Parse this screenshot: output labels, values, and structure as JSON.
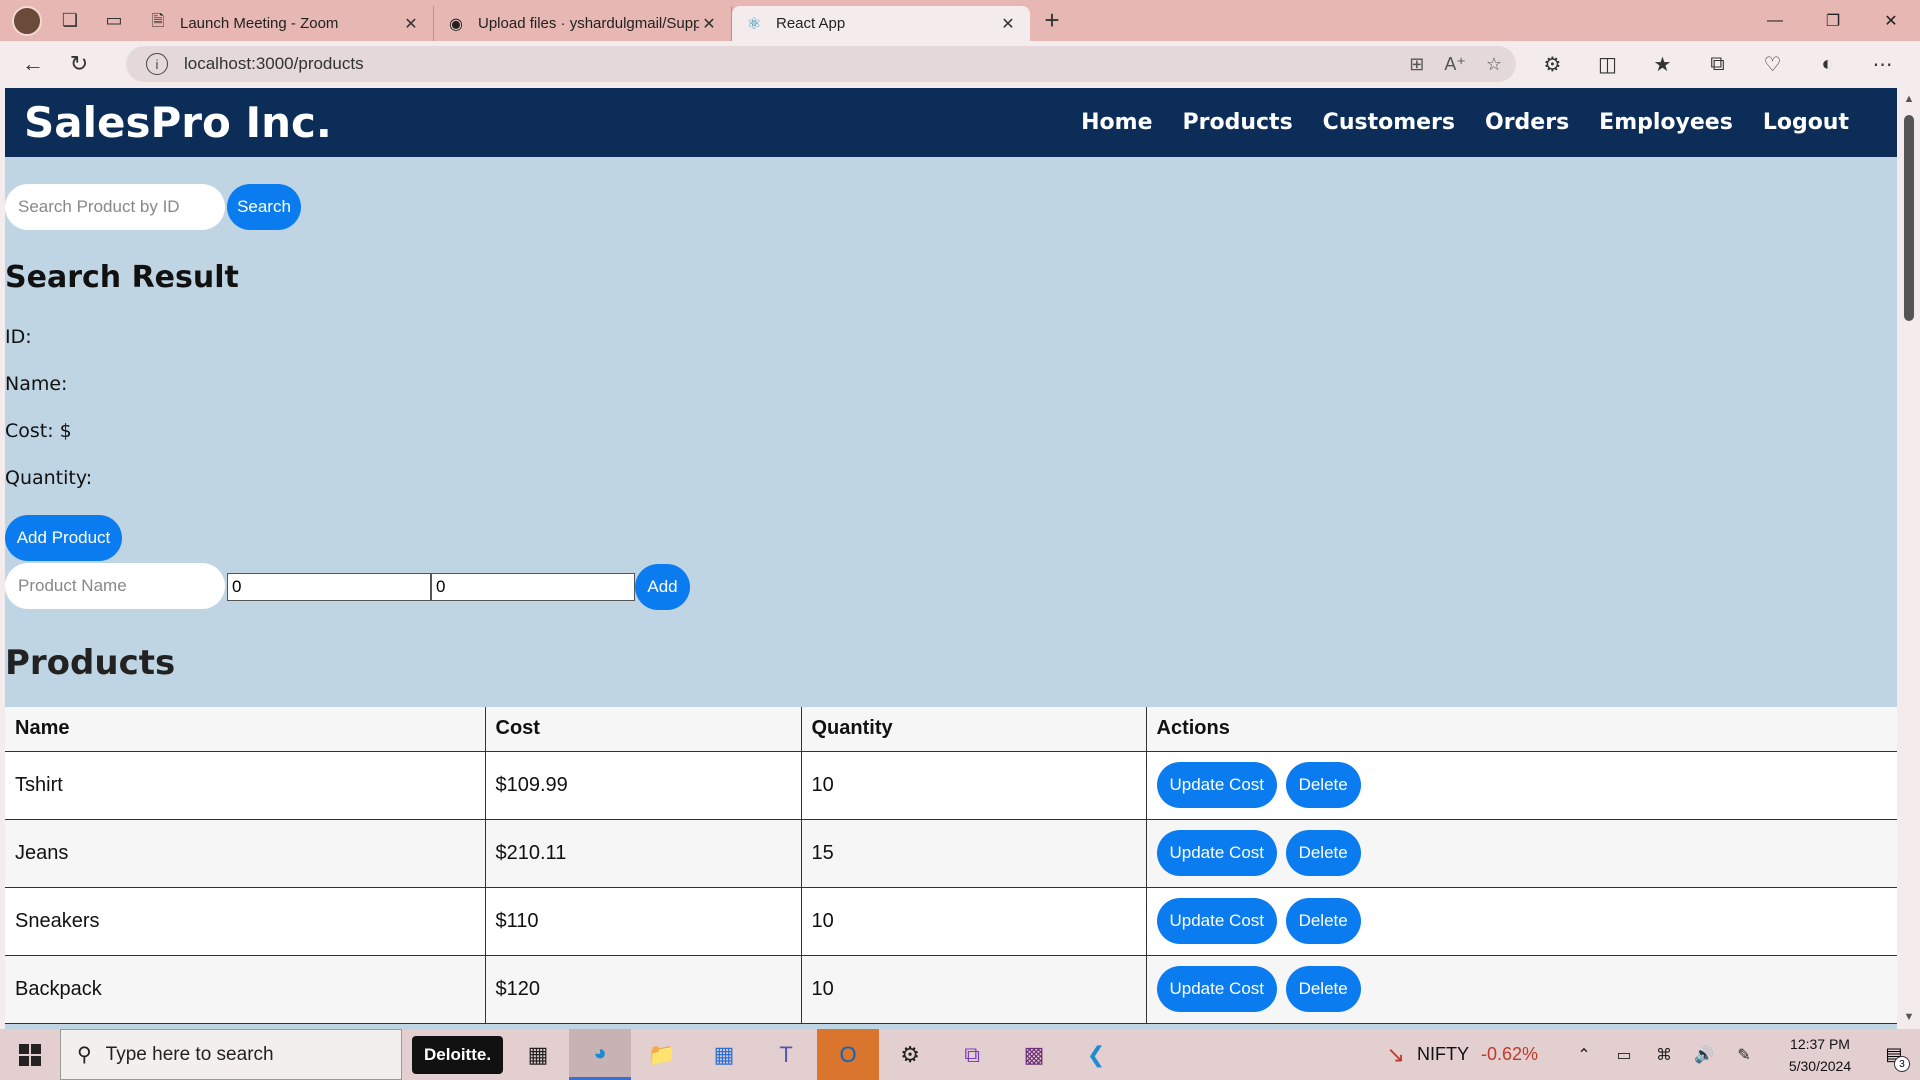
{
  "browser": {
    "tabs": [
      {
        "title": "Launch Meeting - Zoom",
        "icon": "document-icon",
        "active": false
      },
      {
        "title": "Upload files · yshardulgmail/Supp",
        "icon": "github-icon",
        "active": false
      },
      {
        "title": "React App",
        "icon": "react-icon",
        "active": true
      }
    ],
    "url": "localhost:3000/products"
  },
  "header": {
    "brand": "SalesPro Inc.",
    "nav": [
      "Home",
      "Products",
      "Customers",
      "Orders",
      "Employees",
      "Logout"
    ]
  },
  "search": {
    "placeholder": "Search Product by ID",
    "button": "Search"
  },
  "result": {
    "heading": "Search Result",
    "id_label": "ID:",
    "name_label": "Name:",
    "cost_label": "Cost: $",
    "quantity_label": "Quantity:"
  },
  "add_product": {
    "toggle_button": "Add Product",
    "name_placeholder": "Product Name",
    "cost_value": "0",
    "quantity_value": "0",
    "submit_button": "Add"
  },
  "products": {
    "heading": "Products",
    "columns": [
      "Name",
      "Cost",
      "Quantity",
      "Actions"
    ],
    "rows": [
      {
        "name": "Tshirt",
        "cost": "$109.99",
        "quantity": "10"
      },
      {
        "name": "Jeans",
        "cost": "$210.11",
        "quantity": "15"
      },
      {
        "name": "Sneakers",
        "cost": "$110",
        "quantity": "10"
      },
      {
        "name": "Backpack",
        "cost": "$120",
        "quantity": "10"
      }
    ],
    "update_label": "Update Cost",
    "delete_label": "Delete"
  },
  "taskbar": {
    "search_placeholder": "Type here to search",
    "deloitte": "Deloitte.",
    "ticker_name": "NIFTY",
    "ticker_change": "-0.62%",
    "time": "12:37 PM",
    "date": "5/30/2024",
    "notification_count": "3"
  },
  "colors": {
    "header_bg": "#0c2d57",
    "page_bg": "#bfd5e4",
    "button_blue": "#0a7cf0",
    "tab_strip": "#e6b7b3"
  }
}
